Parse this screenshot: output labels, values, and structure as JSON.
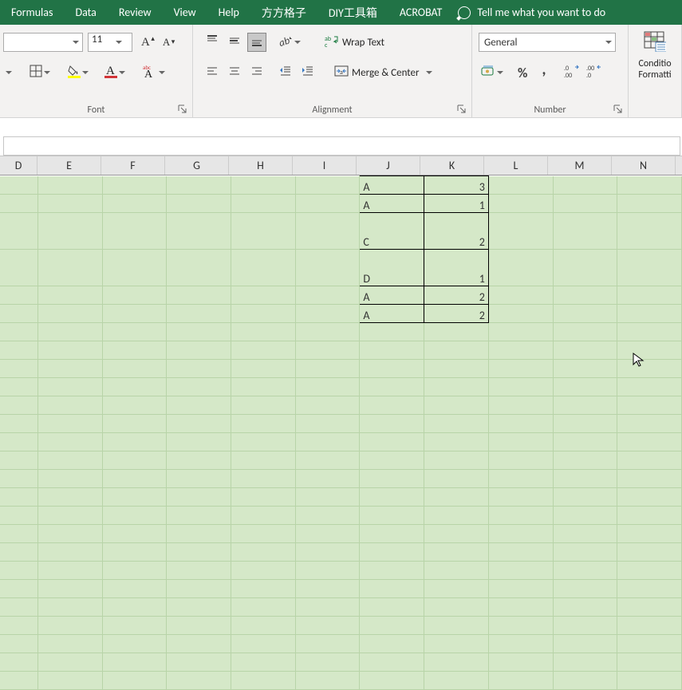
{
  "tabs": {
    "formulas": "Formulas",
    "data": "Data",
    "review": "Review",
    "view": "View",
    "help": "Help",
    "ffgz": "方方格子",
    "diy": "DIY工具箱",
    "acrobat": "ACROBAT",
    "tell_me": "Tell me what you want to do"
  },
  "ribbon": {
    "font": {
      "size": "11",
      "group_label": "Font"
    },
    "alignment": {
      "wrap_text": "Wrap Text",
      "merge_center": "Merge & Center",
      "group_label": "Alignment"
    },
    "number": {
      "format": "General",
      "group_label": "Number"
    },
    "cond": {
      "line1": "Conditio",
      "line2": "Formatti"
    }
  },
  "formula_bar": {
    "value": ""
  },
  "columns": [
    "D",
    "E",
    "F",
    "G",
    "H",
    "I",
    "J",
    "K",
    "L",
    "M",
    "N"
  ],
  "cells": {
    "r1": {
      "j": "A",
      "k": "3"
    },
    "r2": {
      "j": "A",
      "k": "1"
    },
    "r3": {
      "j": "C",
      "k": "2"
    },
    "r4": {
      "j": "D",
      "k": "1"
    },
    "r5": {
      "j": "A",
      "k": "2"
    },
    "r6": {
      "j": "A",
      "k": "2"
    }
  }
}
